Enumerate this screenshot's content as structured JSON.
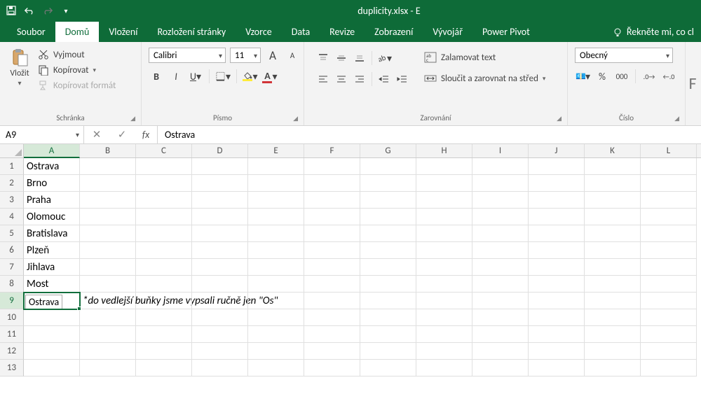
{
  "titlebar": {
    "filename": "duplicity.xlsx - E"
  },
  "tabs": {
    "soubor": "Soubor",
    "domu": "Domů",
    "vlozeni": "Vložení",
    "rozlozeni": "Rozložení stránky",
    "vzorce": "Vzorce",
    "data": "Data",
    "revize": "Revize",
    "zobrazeni": "Zobrazení",
    "vyvojar": "Vývojář",
    "power_pivot": "Power Pivot",
    "tell_me": "Řekněte mi, co cl"
  },
  "ribbon": {
    "clipboard": {
      "paste": "Vložit",
      "cut": "Vyjmout",
      "copy": "Kopírovat",
      "format_painter": "Kopírovat formát",
      "label": "Schránka"
    },
    "font": {
      "name": "Calibri",
      "size": "11",
      "label": "Písmo"
    },
    "alignment": {
      "wrap": "Zalamovat text",
      "merge": "Sloučit a zarovnat na střed",
      "label": "Zarovnání"
    },
    "number": {
      "format": "Obecný",
      "label": "Číslo"
    }
  },
  "formula_bar": {
    "name_box": "A9",
    "fx": "fx",
    "value": "Ostrava"
  },
  "grid": {
    "columns": [
      "A",
      "B",
      "C",
      "D",
      "E",
      "F",
      "G",
      "H",
      "I",
      "J",
      "K",
      "L"
    ],
    "row_count": 13,
    "active_row": 9,
    "active_col": "A",
    "tooltip_text": "Ostrava",
    "data": {
      "A1": "Ostrava",
      "A2": "Brno",
      "A3": "Praha",
      "A4": "Olomouc",
      "A5": "Bratislava",
      "A6": "Plzeň",
      "A7": "Jihlava",
      "A8": "Most",
      "B9": "*do vedlejší buňky jsme vypsali ručně jen \"Os\""
    }
  },
  "chart_data": {
    "type": "table",
    "columns": [
      "A",
      "B"
    ],
    "rows": [
      [
        "Ostrava",
        ""
      ],
      [
        "Brno",
        ""
      ],
      [
        "Praha",
        ""
      ],
      [
        "Olomouc",
        ""
      ],
      [
        "Bratislava",
        ""
      ],
      [
        "Plzeň",
        ""
      ],
      [
        "Jihlava",
        ""
      ],
      [
        "Most",
        ""
      ],
      [
        "",
        "*do vedlejší buňky jsme vypsali ručně jen \"Os\""
      ]
    ]
  }
}
